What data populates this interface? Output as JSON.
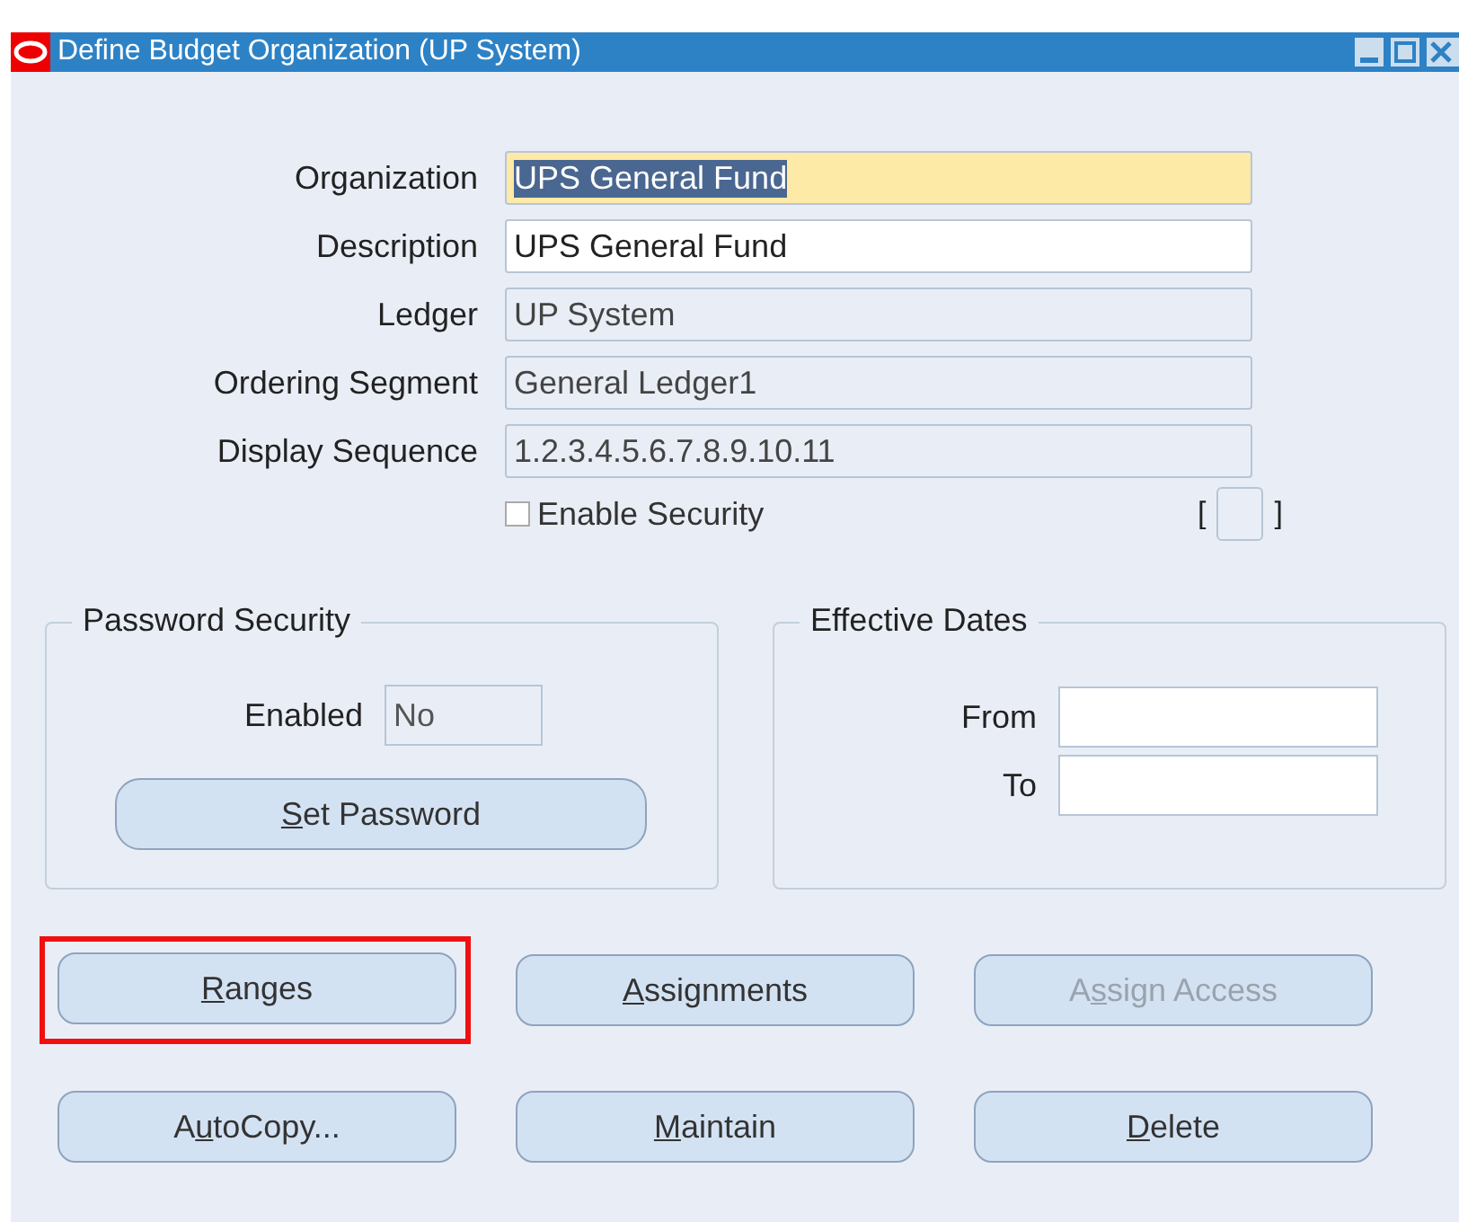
{
  "window": {
    "title": "Define Budget Organization (UP System)"
  },
  "fields": [
    {
      "label": "Organization",
      "value": "UPS General Fund",
      "kind": "focused"
    },
    {
      "label": "Description",
      "value": "UPS General Fund",
      "kind": "editable"
    },
    {
      "label": "Ledger",
      "value": "UP System",
      "kind": "readonly"
    },
    {
      "label": "Ordering Segment",
      "value": "General Ledger1",
      "kind": "readonly"
    },
    {
      "label": "Display Sequence",
      "value": "1.2.3.4.5.6.7.8.9.10.11",
      "kind": "readonly"
    }
  ],
  "enable_security": {
    "label": "Enable Security",
    "checked": false
  },
  "descriptive_flex": {
    "open": "[",
    "close": "]"
  },
  "password_security": {
    "title": "Password Security",
    "enabled_label": "Enabled",
    "enabled_value": "No",
    "button": {
      "label": {
        "key": "S",
        "after": "et Password"
      }
    }
  },
  "effective_dates": {
    "title": "Effective Dates",
    "from_label": "From",
    "to_label": "To"
  },
  "buttons": [
    {
      "label": {
        "key": "R",
        "after": "anges"
      },
      "disabled": false,
      "highlighted": true
    },
    {
      "label": {
        "key": "A",
        "after": "ssignments"
      },
      "disabled": false,
      "highlighted": false
    },
    {
      "label": {
        "before": "A",
        "key": "s",
        "after": "sign Access"
      },
      "disabled": true,
      "highlighted": false
    },
    {
      "label": {
        "before": "A",
        "key": "u",
        "after": "toCopy..."
      },
      "disabled": false,
      "highlighted": false
    },
    {
      "label": {
        "key": "M",
        "after": "aintain"
      },
      "disabled": false,
      "highlighted": false
    },
    {
      "label": {
        "key": "D",
        "after": "elete"
      },
      "disabled": false,
      "highlighted": false
    }
  ]
}
